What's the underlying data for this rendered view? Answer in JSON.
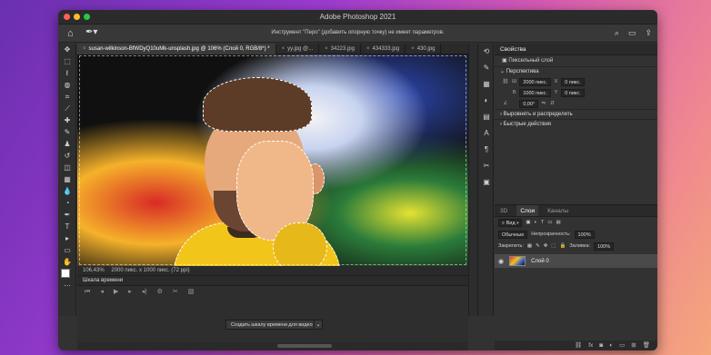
{
  "app": {
    "title": "Adobe Photoshop 2021"
  },
  "options_bar": {
    "hint": "Инструмент \"Перо\" (добавить опорную точку) не имеет параметров."
  },
  "tabs": [
    {
      "label": "susan-wilkinson-BfWDyQ10uMk-unsplash.jpg @ 106% (Слой 0, RGB/8*) *",
      "active": true
    },
    {
      "label": "yy.jpg @...",
      "active": false
    },
    {
      "label": "34223.jpg",
      "active": false
    },
    {
      "label": "434333.jpg",
      "active": false
    },
    {
      "label": "430.jpg",
      "active": false
    }
  ],
  "status": {
    "zoom": "106,43%",
    "doc": "2000 пикс. x 1000 пикс. (72 ppi)"
  },
  "properties": {
    "title": "Свойства",
    "layer_type": "Пиксельный слой",
    "section_transform": "Перспектива",
    "w_label": "Ш",
    "w_value": "2000 пикс.",
    "h_label": "В",
    "h_value": "1000 пикс.",
    "x_label": "X",
    "x_value": "0 пикс.",
    "y_label": "Y",
    "y_value": "0 пикс.",
    "angle_value": "0,00°",
    "section_align": "Выровнять и распределить",
    "section_quick": "Быстрые действия"
  },
  "layers_panel": {
    "tabs": [
      "3D",
      "Слои",
      "Каналы"
    ],
    "filter": "Вид",
    "blend_mode": "Обычные",
    "opacity_label": "Непрозрачность:",
    "opacity_value": "100%",
    "lock_label": "Закрепить:",
    "fill_label": "Заливка:",
    "fill_value": "100%",
    "layer_name": "Слой 0"
  },
  "timeline": {
    "title": "Шкала времени",
    "create_button": "Создать шкалу времени для видео"
  }
}
